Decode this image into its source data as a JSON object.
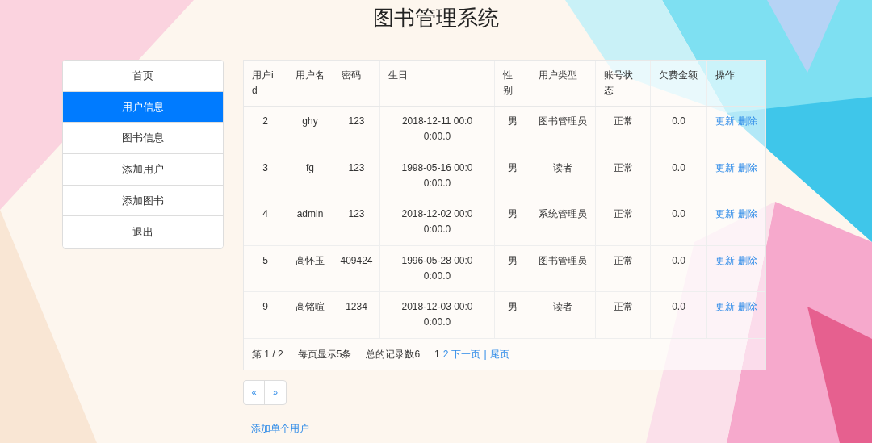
{
  "title": "图书管理系统",
  "sidebar": {
    "items": [
      {
        "label": "首页",
        "selected": false
      },
      {
        "label": "用户信息",
        "selected": true
      },
      {
        "label": "图书信息",
        "selected": false
      },
      {
        "label": "添加用户",
        "selected": false
      },
      {
        "label": "添加图书",
        "selected": false
      },
      {
        "label": "退出",
        "selected": false
      }
    ]
  },
  "table": {
    "columns": [
      "用户id",
      "用户名",
      "密码",
      "生日",
      "性别",
      "用户类型",
      "账号状态",
      "欠费金额",
      "操作"
    ],
    "rows": [
      {
        "cells": [
          "2",
          "ghy",
          "123",
          "2018-12-11 00:00:00.0",
          "男",
          "图书管理员",
          "正常",
          "0.0"
        ],
        "actions": [
          "更新",
          "删除"
        ]
      },
      {
        "cells": [
          "3",
          "fg",
          "123",
          "1998-05-16 00:00:00.0",
          "男",
          "读者",
          "正常",
          "0.0"
        ],
        "actions": [
          "更新",
          "删除"
        ]
      },
      {
        "cells": [
          "4",
          "admin",
          "123",
          "2018-12-02 00:00:00.0",
          "男",
          "系统管理员",
          "正常",
          "0.0"
        ],
        "actions": [
          "更新",
          "删除"
        ]
      },
      {
        "cells": [
          "5",
          "高怀玉",
          "409424",
          "1996-05-28 00:00:00.0",
          "男",
          "图书管理员",
          "正常",
          "0.0"
        ],
        "actions": [
          "更新",
          "删除"
        ]
      },
      {
        "cells": [
          "9",
          "高铭暄",
          "1234",
          "2018-12-03 00:00:00.0",
          "男",
          "读者",
          "正常",
          "0.0"
        ],
        "actions": [
          "更新",
          "删除"
        ]
      }
    ]
  },
  "paging": {
    "page": "第 1 / 2",
    "per_page": "每页显示5条",
    "total": "总的记录数6",
    "pages": [
      {
        "label": "1",
        "kind": "current"
      },
      {
        "label": "2",
        "kind": "link"
      },
      {
        "label": "下一页",
        "kind": "link"
      },
      {
        "label": "|",
        "kind": "separator"
      },
      {
        "label": "尾页",
        "kind": "link"
      }
    ]
  },
  "pager": [
    "«",
    "»"
  ],
  "add_link": "添加单个用户"
}
